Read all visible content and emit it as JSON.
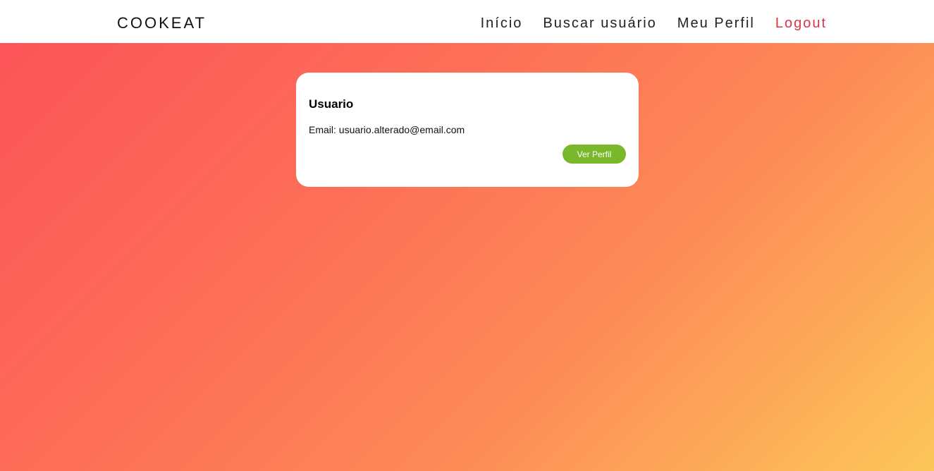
{
  "navbar": {
    "brand": "COOKEAT",
    "links": [
      {
        "label": "Início"
      },
      {
        "label": "Buscar usuário"
      },
      {
        "label": "Meu Perfil"
      },
      {
        "label": "Logout",
        "color": "#dc3545"
      }
    ]
  },
  "user_card": {
    "name": "Usuario",
    "email_line": "Email: usuario.alterado@email.com",
    "button_label": "Ver Perfil",
    "button_color": "#79b82a"
  },
  "colors": {
    "gradient_start": "#fc5259",
    "gradient_end": "#fdc759",
    "navbar_bg": "#ffffff"
  }
}
